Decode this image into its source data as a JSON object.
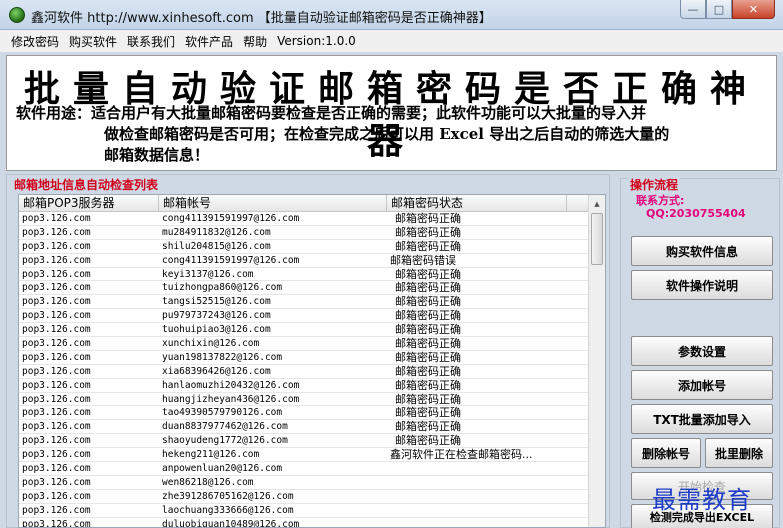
{
  "window": {
    "title": "鑫河软件 http://www.xinhesoft.com 【批量自动验证邮箱密码是否正确神器】",
    "min_glyph": "—",
    "max_glyph": "□",
    "close_glyph": "✕"
  },
  "menu": [
    "修改密码",
    "购买软件",
    "联系我们",
    "软件产品",
    "帮助",
    "Version:1.0.0"
  ],
  "banner": {
    "title": "批量自动验证邮箱密码是否正确神器",
    "desc_line1": "软件用途：适合用户有大批量邮箱密码要检查是否正确的需要；此软件功能可以大批量的导入并",
    "desc_line2": "做检查邮箱密码是否可用；在检查完成之后可以用 Excel 导出之后自动的筛选大量的",
    "desc_line3": "邮箱数据信息！"
  },
  "list": {
    "group_label": "邮箱地址信息自动检查列表",
    "columns": [
      "邮箱POP3服务器",
      "邮箱帐号",
      "邮箱密码状态"
    ],
    "rows": [
      {
        "server": "pop3.126.com",
        "account": "cong411391591997@126.com",
        "status": "邮箱密码正确"
      },
      {
        "server": "pop3.126.com",
        "account": "mu284911832@126.com",
        "status": "邮箱密码正确"
      },
      {
        "server": "pop3.126.com",
        "account": "shilu204815@126.com",
        "status": "邮箱密码正确"
      },
      {
        "server": "pop3.126.com",
        "account": "cong411391591997@126.com",
        "status": "邮箱密码错误"
      },
      {
        "server": "pop3.126.com",
        "account": "keyi3137@126.com",
        "status": "邮箱密码正确"
      },
      {
        "server": "pop3.126.com",
        "account": "tuizhongpa860@126.com",
        "status": "邮箱密码正确"
      },
      {
        "server": "pop3.126.com",
        "account": "tangsi52515@126.com",
        "status": "邮箱密码正确"
      },
      {
        "server": "pop3.126.com",
        "account": "pu979737243@126.com",
        "status": "邮箱密码正确"
      },
      {
        "server": "pop3.126.com",
        "account": "tuohuipiao3@126.com",
        "status": "邮箱密码正确"
      },
      {
        "server": "pop3.126.com",
        "account": "xunchixin@126.com",
        "status": "邮箱密码正确"
      },
      {
        "server": "pop3.126.com",
        "account": "yuan198137822@126.com",
        "status": "邮箱密码正确"
      },
      {
        "server": "pop3.126.com",
        "account": "xia68396426@126.com",
        "status": "邮箱密码正确"
      },
      {
        "server": "pop3.126.com",
        "account": "hanlaomuzhi20432@126.com",
        "status": "邮箱密码正确"
      },
      {
        "server": "pop3.126.com",
        "account": "huangjizheyan436@126.com",
        "status": "邮箱密码正确"
      },
      {
        "server": "pop3.126.com",
        "account": "tao49390579790126.com",
        "status": "邮箱密码正确"
      },
      {
        "server": "pop3.126.com",
        "account": "duan8837977462@126.com",
        "status": "邮箱密码正确"
      },
      {
        "server": "pop3.126.com",
        "account": "shaoyudeng1772@126.com",
        "status": "邮箱密码正确"
      },
      {
        "server": "pop3.126.com",
        "account": "hekeng211@126.com",
        "status": "鑫河软件正在检查邮箱密码..."
      },
      {
        "server": "pop3.126.com",
        "account": "anpowenluan20@126.com",
        "status": ""
      },
      {
        "server": "pop3.126.com",
        "account": "wen86218@126.com",
        "status": ""
      },
      {
        "server": "pop3.126.com",
        "account": "zhe391286705162@126.com",
        "status": ""
      },
      {
        "server": "pop3.126.com",
        "account": "laochuang333666@126.com",
        "status": ""
      },
      {
        "server": "pop3.126.com",
        "account": "duluobiguan10489@126.com",
        "status": ""
      }
    ]
  },
  "ops": {
    "group_label": "操作流程",
    "contact_label": "联系方式:",
    "contact_qq": "QQ:2030755404",
    "buy_info": "购买软件信息",
    "instructions": "软件操作说明",
    "settings": "参数设置",
    "add_account": "添加帐号",
    "txt_import": "TXT批量添加导入",
    "delete_account": "删除帐号",
    "batch_delete": "批里删除",
    "start_check": "开始检查",
    "export_excel": "检测完成导出EXCEL"
  },
  "watermark": "最需教育"
}
